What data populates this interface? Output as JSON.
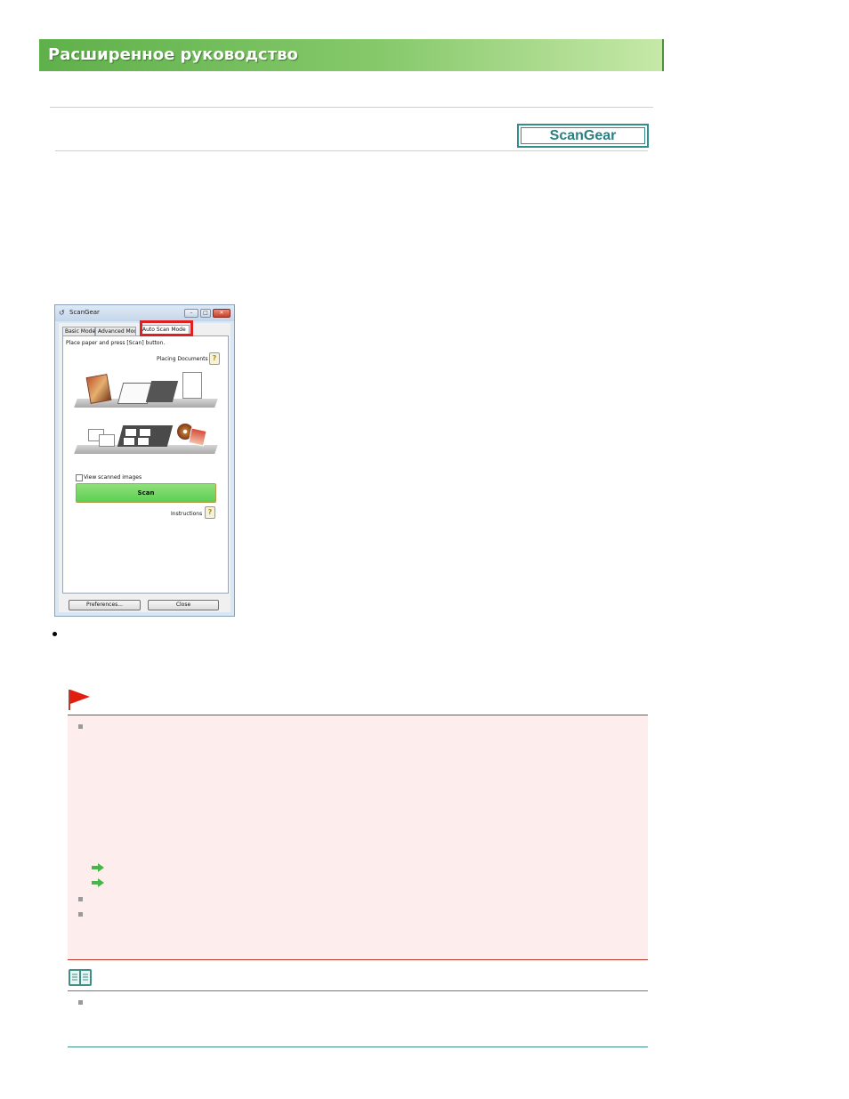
{
  "header": {
    "title": "Расширенное руководство"
  },
  "badge": {
    "label": "ScanGear"
  },
  "dialog": {
    "title": "ScanGear",
    "tabs": [
      "Basic Mode",
      "Advanced Mode",
      "Auto Scan Mode"
    ],
    "instruction": "Place paper and press [Scan] button.",
    "placing_documents": "Placing Documents",
    "view_scanned_images": "View scanned images",
    "scan_button": "Scan",
    "instructions_link": "Instructions",
    "preferences_button": "Preferences...",
    "close_button": "Close"
  },
  "colors": {
    "banner": "#5fb04b",
    "badge": "#2f8f8a",
    "important_border": "#c0392b",
    "important_bg": "#fdeeed",
    "note_border": "#3f8f86",
    "highlight": "#e02020"
  }
}
